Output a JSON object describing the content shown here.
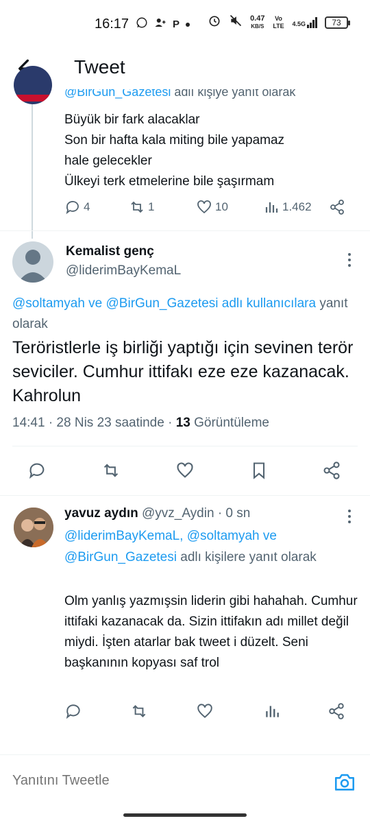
{
  "status_bar": {
    "time": "16:17",
    "speed_value": "0.47",
    "speed_unit": "KB/S",
    "network": "Vo LTE",
    "signal": "4.5G",
    "battery": "73"
  },
  "header": {
    "title": "Tweet"
  },
  "previous_tweet": {
    "reply_to_mention": "@BirGun_Gazetesi",
    "reply_to_suffix": " adlı kişiye yanıt olarak",
    "text_lines": [
      "Büyük bir fark alacaklar",
      "Son bir hafta kala miting bile yapamaz",
      "hale gelecekler",
      "Ülkeyi terk etmelerine bile şaşırmam"
    ],
    "replies": "4",
    "retweets": "1",
    "likes": "10",
    "views": "1.462"
  },
  "main_tweet": {
    "name": "Kemalist genç",
    "handle": "@liderimBayKemaL",
    "reply_mention_1": "@soltamyah",
    "reply_and": " ve ",
    "reply_mention_2": "@BirGun_Gazetesi adlı kullanıcılara",
    "reply_suffix": " yanıt olarak",
    "text": "Teröristlerle iş birliği yaptığı için sevinen terör seviciler. Cumhur ittifakı eze eze kazanacak. Kahrolun",
    "time_date": "14:41 · 28 Nis 23 saatinde · ",
    "view_count": "13",
    "view_label": " Görüntüleme"
  },
  "reply_tweet": {
    "name": "yavuz aydın",
    "handle": "@yvz_Aydin",
    "time": "· 0 sn",
    "reply_mention_1": "@liderimBayKemaL, @soltamyah",
    "reply_and": " ve ",
    "reply_mention_2": "@BirGun_Gazetesi",
    "reply_suffix": " adlı kişilere yanıt olarak",
    "text": "Olm yanlış yazmışsin liderin gibi hahahah. Cumhur ittifaki kazanacak da. Sizin ittifakın adı millet değil miydi. İşten atarlar bak tweet i düzelt. Seni başkanının kopyası saf trol"
  },
  "compose": {
    "placeholder": "Yanıtını Tweetle"
  },
  "colors": {
    "accent": "#1d9bf0",
    "text": "#0f1419",
    "muted": "#536471",
    "divider": "#eff3f4"
  }
}
